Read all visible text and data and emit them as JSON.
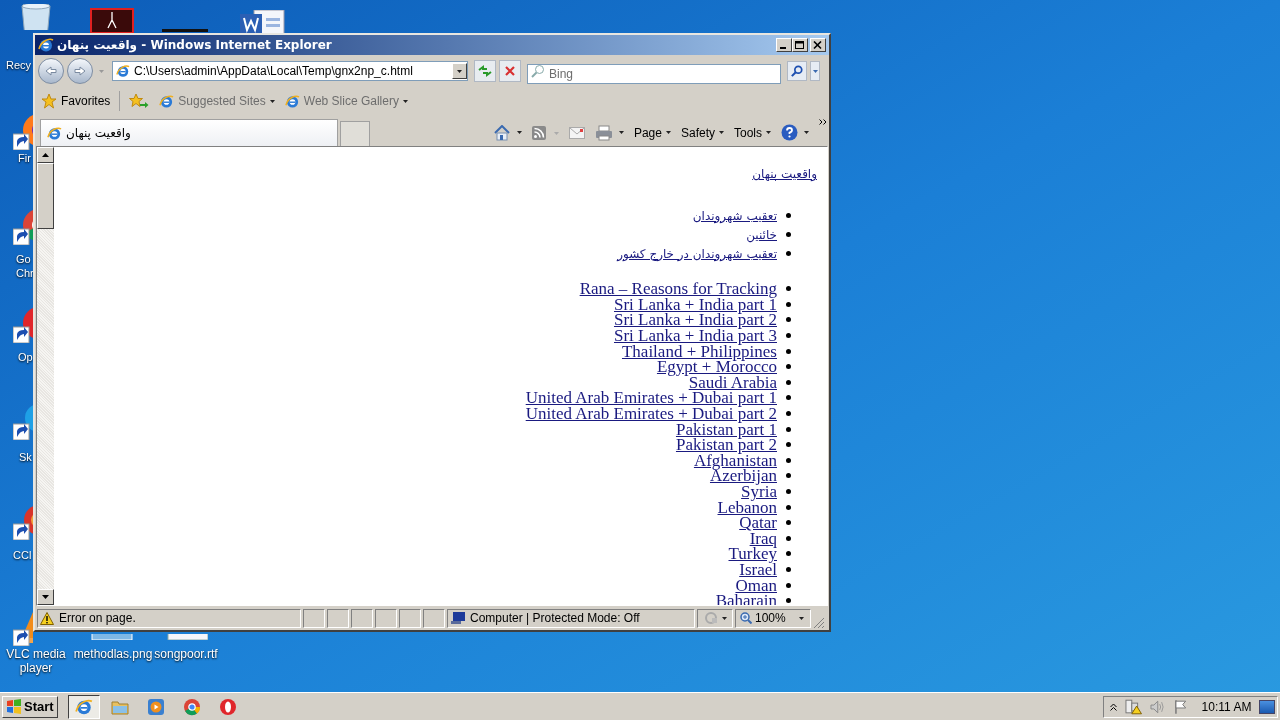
{
  "desktop": {
    "icons": [
      {
        "label": "Recy",
        "kind": "recycle"
      },
      {
        "label": "Fir",
        "kind": "fox"
      },
      {
        "label": "Go Chr",
        "kind": "chrome"
      },
      {
        "label": "Op",
        "kind": "opera"
      },
      {
        "label": "Sk",
        "kind": "skype"
      },
      {
        "label": "CCl",
        "kind": "cleaner"
      },
      {
        "label": "VLC media player",
        "kind": "cone"
      },
      {
        "label": "methodlas.png",
        "kind": "image"
      },
      {
        "label": "songpoor.rtf",
        "kind": "document"
      }
    ]
  },
  "window": {
    "title": "واقعیت پنهان - Windows Internet Explorer",
    "address": "C:\\Users\\admin\\AppData\\Local\\Temp\\gnx2np_c.html",
    "search": {
      "placeholder": "Bing"
    },
    "favorites": {
      "label": "Favorites",
      "items": [
        "Suggested Sites",
        "Web Slice Gallery"
      ]
    },
    "tab": {
      "label": "واقعیت پنهان"
    },
    "commands": [
      "Page",
      "Safety",
      "Tools"
    ],
    "page": {
      "site_title": "واقعیت پنهان",
      "nav_links": [
        "تعقیب شهروندان",
        "خائنین",
        "تعقیب شهروندان در خارج کشور"
      ],
      "posts": [
        "Rana – Reasons for Tracking",
        "Sri Lanka + India part 1",
        "Sri Lanka + India part 2",
        "Sri Lanka + India part 3",
        "Thailand + Philippines",
        "Egypt + Morocco",
        "Saudi Arabia",
        "United Arab Emirates + Dubai part 1",
        "United Arab Emirates + Dubai part 2",
        "Pakistan part 1",
        "Pakistan part 2",
        "Afghanistan",
        "Azerbijan",
        "Syria",
        "Lebanon",
        "Qatar",
        "Iraq",
        "Turkey",
        "Israel",
        "Oman",
        "Baharain"
      ]
    },
    "status_bar": {
      "message": "Error on page.",
      "zone": "Computer | Protected Mode: Off",
      "zoom": "100%"
    }
  },
  "taskbar": {
    "start": "Start",
    "apps": [
      {
        "kind": "browser",
        "selected": true
      },
      {
        "kind": "folder",
        "selected": false
      },
      {
        "kind": "media",
        "selected": false
      },
      {
        "kind": "chrome",
        "selected": false
      },
      {
        "kind": "opera",
        "selected": false
      }
    ],
    "clock": "10:11 AM"
  }
}
